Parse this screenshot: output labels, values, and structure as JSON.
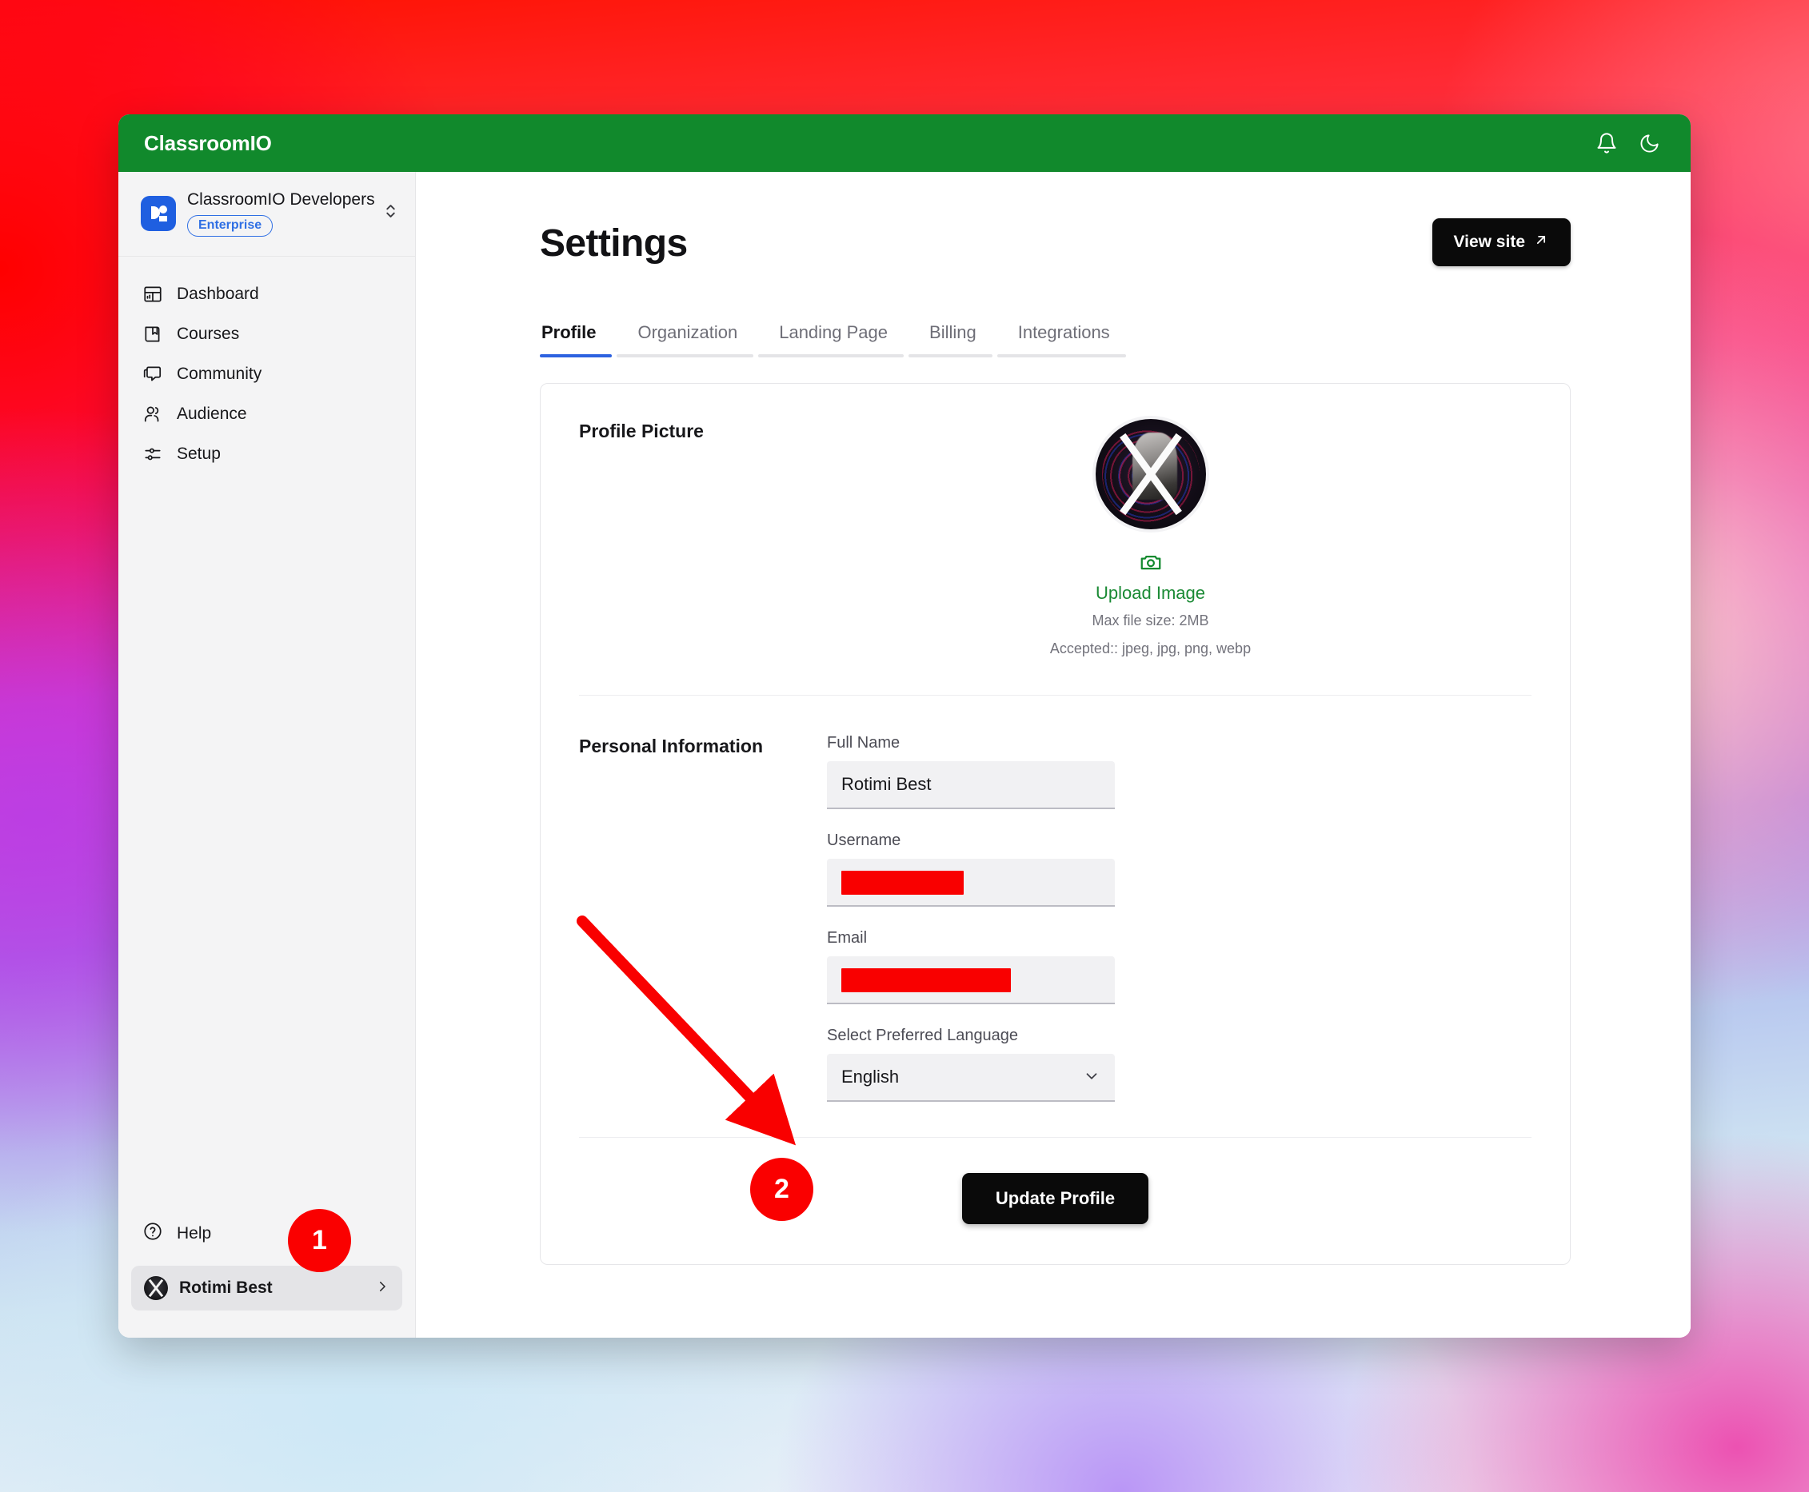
{
  "app": {
    "brand": "ClassroomIO",
    "header_icons": [
      {
        "name": "bell-icon",
        "label": "Notifications"
      },
      {
        "name": "moon-icon",
        "label": "Dark mode"
      }
    ]
  },
  "sidebar": {
    "org": {
      "name": "ClassroomIO Developers",
      "plan_badge": "Enterprise",
      "logo_icon": "classroomio-org-logo",
      "switcher_icon": "chevron-up-down-icon"
    },
    "nav_items": [
      {
        "label": "Dashboard",
        "icon": "dashboard-icon"
      },
      {
        "label": "Courses",
        "icon": "book-icon"
      },
      {
        "label": "Community",
        "icon": "chat-icon"
      },
      {
        "label": "Audience",
        "icon": "users-icon"
      },
      {
        "label": "Setup",
        "icon": "sliders-icon"
      }
    ],
    "help": {
      "label": "Help",
      "icon": "question-circle-icon"
    },
    "user": {
      "name": "Rotimi Best",
      "avatar_icon": "x-avatar",
      "chevron_icon": "chevron-right-icon"
    }
  },
  "main": {
    "page_title": "Settings",
    "view_site_button": "View site",
    "view_site_icon": "arrow-up-right-icon",
    "tabs": [
      {
        "label": "Profile",
        "active": true
      },
      {
        "label": "Organization",
        "active": false
      },
      {
        "label": "Landing Page",
        "active": false
      },
      {
        "label": "Billing",
        "active": false
      },
      {
        "label": "Integrations",
        "active": false
      }
    ],
    "profile_picture": {
      "section_title": "Profile Picture",
      "avatar_icon": "x-profile-avatar",
      "upload_icon": "camera-icon",
      "upload_label": "Upload Image",
      "max_size_hint": "Max file size: 2MB",
      "accepted_hint": "Accepted:: jpeg, jpg, png, webp"
    },
    "personal_information": {
      "section_title": "Personal Information",
      "fields": [
        {
          "label": "Full Name",
          "value": "Rotimi Best",
          "redacted": false
        },
        {
          "label": "Username",
          "value": "",
          "redacted": true
        },
        {
          "label": "Email",
          "value": "",
          "redacted": true
        }
      ],
      "language_field": {
        "label": "Select Preferred Language",
        "value": "English",
        "chevron_icon": "chevron-down-icon"
      }
    },
    "update_button": "Update Profile"
  },
  "annotations": {
    "badges": [
      {
        "id": "badge-1",
        "number": "1"
      },
      {
        "id": "badge-2",
        "number": "2"
      }
    ],
    "arrow_color": "#f90000"
  }
}
